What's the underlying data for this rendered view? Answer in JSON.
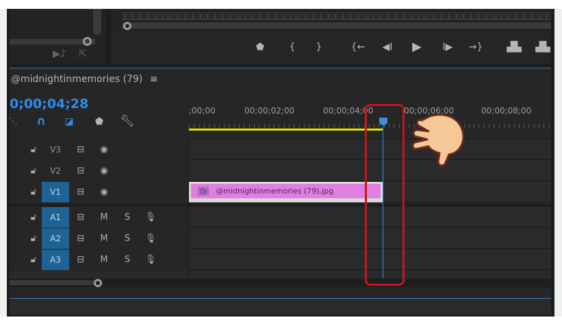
{
  "sequence": {
    "title": "@midnightinmemories (79)",
    "menu_icon": "hamburger-icon",
    "timecode": "0;00;04;28"
  },
  "ruler": {
    "labels": [
      ";00;00",
      "00;00;02;00",
      "00;00;04;00",
      "00;00;06;00",
      "00;00;08;00"
    ]
  },
  "program_controls": [
    "marker-icon",
    "mark-in-icon",
    "mark-out-icon",
    "go-to-in-icon",
    "step-back-icon",
    "play-icon",
    "step-forward-icon",
    "go-to-out-icon",
    "lift-icon",
    "extract-icon"
  ],
  "tracks": {
    "video": [
      {
        "label": "V3",
        "targeted": false
      },
      {
        "label": "V2",
        "targeted": false
      },
      {
        "label": "V1",
        "targeted": true
      }
    ],
    "audio": [
      {
        "label": "A1",
        "mute": "M",
        "solo": "S"
      },
      {
        "label": "A2",
        "mute": "M",
        "solo": "S"
      },
      {
        "label": "A3",
        "mute": "M",
        "solo": "S"
      }
    ]
  },
  "clip": {
    "fx_label": "fx",
    "name": "@midnightinmemories (79).jpg"
  },
  "colors": {
    "accent": "#2d8ceb",
    "clip": "#e07fe0",
    "highlight": "#c8141a",
    "work_area": "#e8e000"
  }
}
